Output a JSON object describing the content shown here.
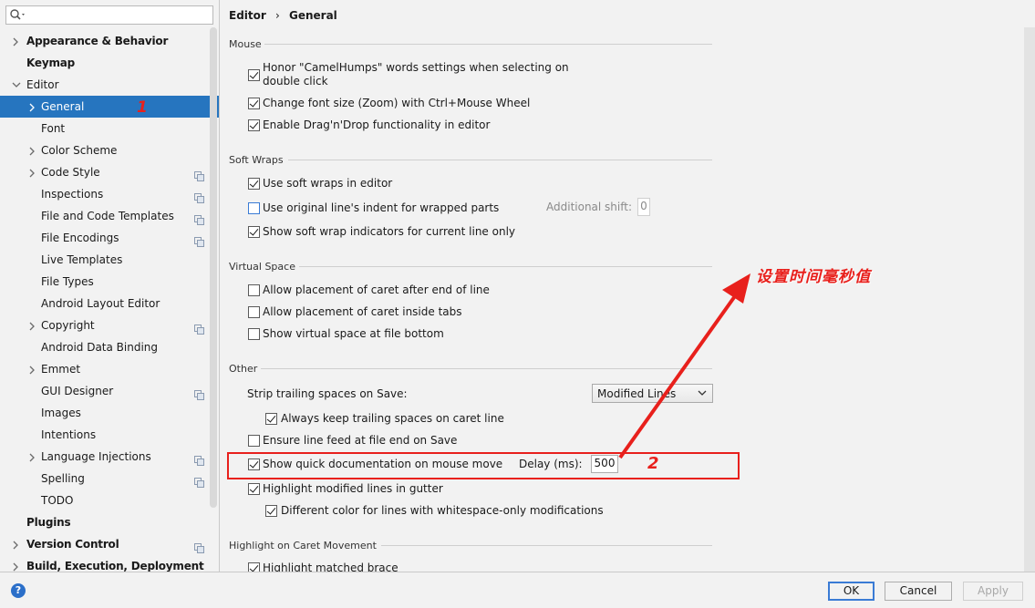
{
  "search": {
    "placeholder": ""
  },
  "tree": [
    {
      "label": "Appearance & Behavior",
      "bold": true,
      "chevron": "right",
      "indent": 0
    },
    {
      "label": "Keymap",
      "bold": true,
      "chevron": "",
      "indent": 0
    },
    {
      "label": "Editor",
      "bold": false,
      "chevron": "down",
      "indent": 0
    },
    {
      "label": "General",
      "bold": false,
      "chevron": "right",
      "indent": 1,
      "selected": true
    },
    {
      "label": "Font",
      "indent": 1,
      "chevron": ""
    },
    {
      "label": "Color Scheme",
      "indent": 1,
      "chevron": "right"
    },
    {
      "label": "Code Style",
      "indent": 1,
      "chevron": "right",
      "copy": true
    },
    {
      "label": "Inspections",
      "indent": 1,
      "chevron": "",
      "copy": true
    },
    {
      "label": "File and Code Templates",
      "indent": 1,
      "chevron": "",
      "copy": true
    },
    {
      "label": "File Encodings",
      "indent": 1,
      "chevron": "",
      "copy": true
    },
    {
      "label": "Live Templates",
      "indent": 1,
      "chevron": ""
    },
    {
      "label": "File Types",
      "indent": 1,
      "chevron": ""
    },
    {
      "label": "Android Layout Editor",
      "indent": 1,
      "chevron": ""
    },
    {
      "label": "Copyright",
      "indent": 1,
      "chevron": "right",
      "copy": true
    },
    {
      "label": "Android Data Binding",
      "indent": 1,
      "chevron": ""
    },
    {
      "label": "Emmet",
      "indent": 1,
      "chevron": "right"
    },
    {
      "label": "GUI Designer",
      "indent": 1,
      "chevron": "",
      "copy": true
    },
    {
      "label": "Images",
      "indent": 1,
      "chevron": ""
    },
    {
      "label": "Intentions",
      "indent": 1,
      "chevron": ""
    },
    {
      "label": "Language Injections",
      "indent": 1,
      "chevron": "right",
      "copy": true
    },
    {
      "label": "Spelling",
      "indent": 1,
      "chevron": "",
      "copy": true
    },
    {
      "label": "TODO",
      "indent": 1,
      "chevron": ""
    },
    {
      "label": "Plugins",
      "bold": true,
      "indent": 0,
      "chevron": ""
    },
    {
      "label": "Version Control",
      "bold": true,
      "indent": 0,
      "chevron": "right",
      "copy": true
    },
    {
      "label": "Build, Execution, Deployment",
      "bold": true,
      "indent": 0,
      "chevron": "right"
    }
  ],
  "breadcrumb": {
    "parent": "Editor",
    "separator": "›",
    "current": "General"
  },
  "sections": {
    "mouse": "Mouse",
    "soft_wraps": "Soft Wraps",
    "virtual_space": "Virtual Space",
    "other": "Other",
    "caret": "Highlight on Caret Movement"
  },
  "options": {
    "camelhumps_1": "Honor \"CamelHumps\" words settings when selecting on",
    "camelhumps_2": "double click",
    "zoom": "Change font size (Zoom) with Ctrl+Mouse Wheel",
    "dragdrop": "Enable Drag'n'Drop functionality in editor",
    "soft_wraps": "Use soft wraps in editor",
    "orig_indent": "Use original line's indent for wrapped parts",
    "additional_shift_label": "Additional shift:",
    "additional_shift_value": "0",
    "wrap_indicators": "Show soft wrap indicators for current line only",
    "caret_after_end": "Allow placement of caret after end of line",
    "caret_inside_tabs": "Allow placement of caret inside tabs",
    "virtual_bottom": "Show virtual space at file bottom",
    "strip_label": "Strip trailing spaces on Save:",
    "strip_value": "Modified Lines",
    "keep_trailing": "Always keep trailing spaces on caret line",
    "line_feed": "Ensure line feed at file end on Save",
    "quick_doc": "Show quick documentation on mouse move",
    "delay_label": "Delay (ms):",
    "delay_value": "500",
    "highlight_modified": "Highlight modified lines in gutter",
    "diff_color": "Different color for lines with whitespace-only modifications",
    "matched_brace": "Highlight matched brace"
  },
  "annotation": {
    "text": "设置时间毫秒值",
    "marker1": "1",
    "marker2": "2",
    "color": "#e8201c"
  },
  "footer": {
    "ok": "OK",
    "cancel": "Cancel",
    "apply": "Apply",
    "help": "?"
  },
  "colors": {
    "selection": "#2675bf",
    "accent": "#3a7bd5"
  }
}
